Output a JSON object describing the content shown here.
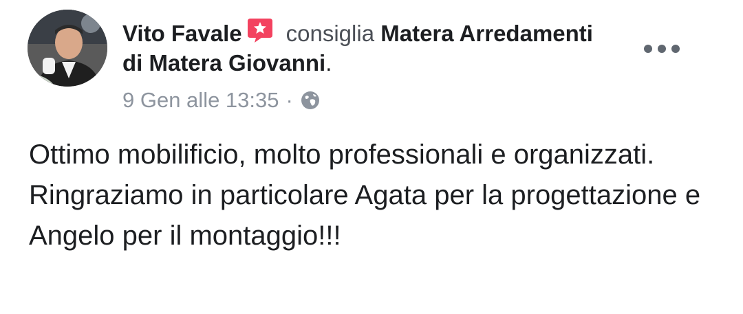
{
  "post": {
    "author": "Vito Favale",
    "action": "consiglia",
    "page_name": "Matera Arredamenti di Matera Giovanni",
    "page_suffix": ".",
    "timestamp": "9 Gen alle 13:35",
    "separator": "·",
    "privacy_icon": "globe-icon",
    "recommend_icon": "recommend-star-icon",
    "more_icon": "more-options-icon",
    "text_line_1": "Ottimo mobilificio, molto professionali e organizzati.",
    "text_line_2": "Ringraziamo in particolare Agata per la progettazione e Angelo per il montaggio!!!"
  },
  "colors": {
    "badge": "#f3425f",
    "meta": "#8d949e",
    "text": "#1c1e21"
  }
}
